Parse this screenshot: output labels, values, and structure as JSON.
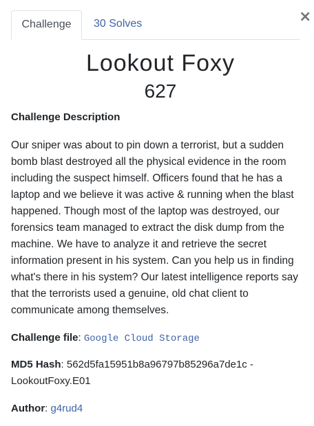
{
  "tabs": {
    "challenge_label": "Challenge",
    "solves_label": "30 Solves"
  },
  "close_icon": "×",
  "challenge": {
    "name": "Lookout Foxy",
    "points": "627",
    "description_heading": "Challenge Description",
    "description_lines": [
      "Our sniper was about to pin down a terrorist, but a sudden",
      "bomb blast destroyed all the physical evidence in the room",
      "including the suspect himself. Officers found that he has a",
      "laptop and we believe it was active & running when the blast",
      "happened. Though most of the laptop was destroyed, our",
      "forensics team managed to extract the disk dump from the",
      "machine. We have to analyze it and retrieve the secret",
      "information present in his system. Can you help us in finding",
      "what's there in his system? Our latest intelligence reports say",
      "that the terrorists used a genuine, old chat client to",
      "communicate among themselves."
    ],
    "file_label": "Challenge file",
    "file_link_text": "Google Cloud Storage",
    "md5_label": "MD5 Hash",
    "md5_value_line1": "562d5fa15951b8a96797b85296a7de1c -",
    "md5_value_line2": "LookoutFoxy.E01",
    "author_label": "Author",
    "author_name": "g4rud4"
  }
}
